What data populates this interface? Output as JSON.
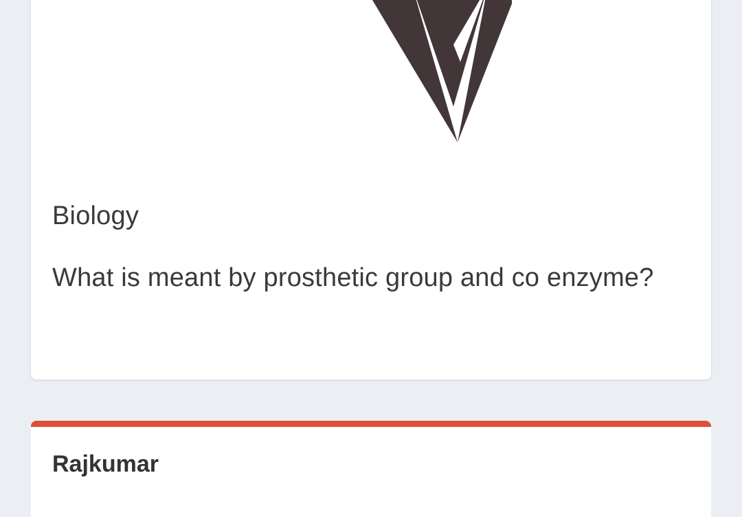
{
  "question_card": {
    "subject": "Biology",
    "question": "What is meant by prosthetic group and co enzyme?",
    "logo": {
      "icon": "v-logo-icon",
      "color": "#433638"
    }
  },
  "answer_card": {
    "author": "Rajkumar",
    "accent_color": "#dd4f3a"
  },
  "page": {
    "background_color": "#ebeff4"
  }
}
